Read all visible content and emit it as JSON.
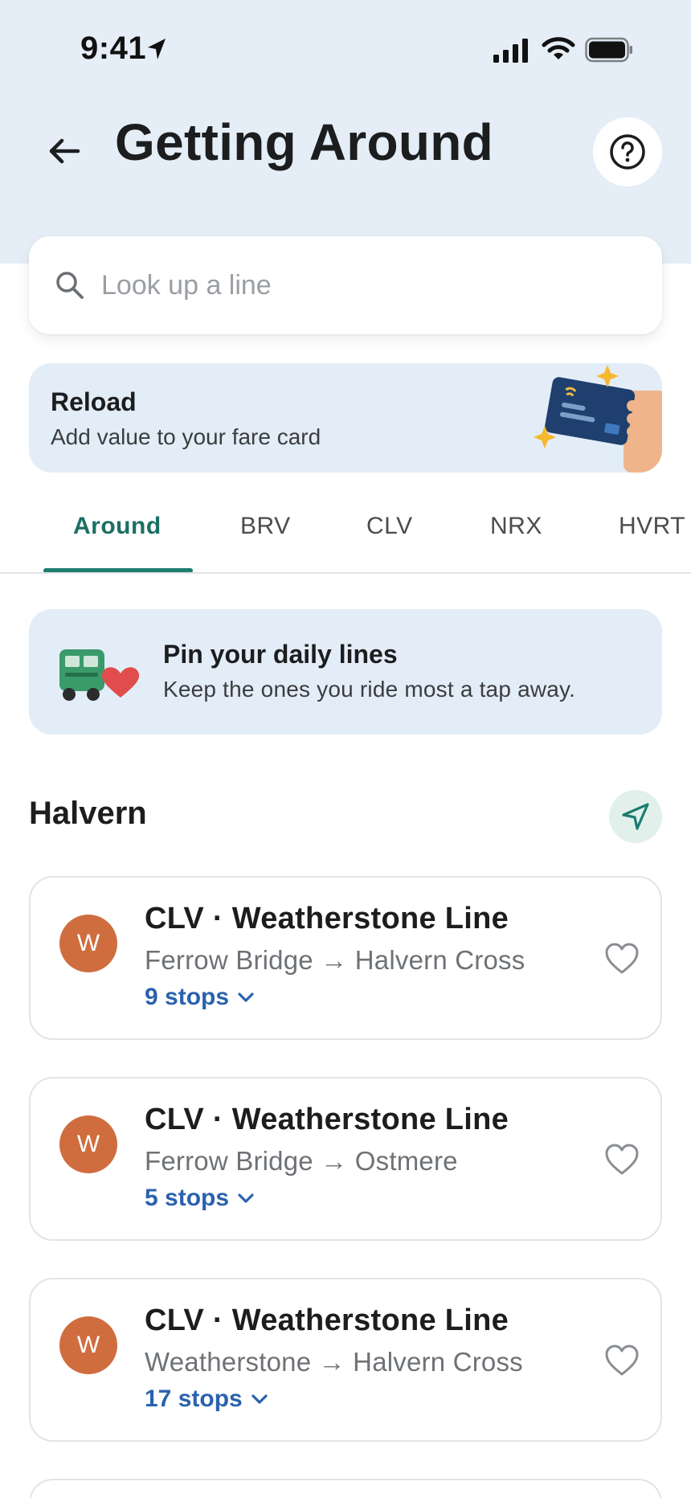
{
  "status_bar": {
    "time": "9:41"
  },
  "header": {
    "title": "Getting Around"
  },
  "search": {
    "placeholder": "Look up a line"
  },
  "reload_banner": {
    "title": "Reload",
    "subtitle": "Add value to your fare card"
  },
  "tabs": [
    {
      "label": "Around",
      "active": true
    },
    {
      "label": "BRV"
    },
    {
      "label": "CLV"
    },
    {
      "label": "NRX"
    },
    {
      "label": "HVRT"
    }
  ],
  "pin_banner": {
    "title": "Pin your daily lines",
    "subtitle": "Keep the ones you ride most a tap away."
  },
  "section": {
    "title": "Halvern"
  },
  "lines": [
    {
      "badge": "W",
      "name": "CLV · Weatherstone Line",
      "route": "Ferrow Bridge → Halvern Cross",
      "stops": "9 stops"
    },
    {
      "badge": "W",
      "name": "CLV · Weatherstone Line",
      "route": "Ferrow Bridge → Ostmere",
      "stops": "5 stops"
    },
    {
      "badge": "W",
      "name": "CLV · Weatherstone Line",
      "route": "Weatherstone → Halvern Cross",
      "stops": "17 stops"
    }
  ],
  "colors": {
    "header_bg": "#e5eef6",
    "accent_teal": "#1c7d6f",
    "link_blue": "#2a62ad",
    "badge_orange": "#cf6d3f",
    "banner_bg": "#e3edf7"
  },
  "icons": {
    "back": "arrow-left-icon",
    "help": "question-circle-icon",
    "search": "magnifier-icon",
    "locate": "navigation-arrow-icon",
    "favorite": "heart-outline-icon",
    "expand": "chevron-down-icon"
  }
}
